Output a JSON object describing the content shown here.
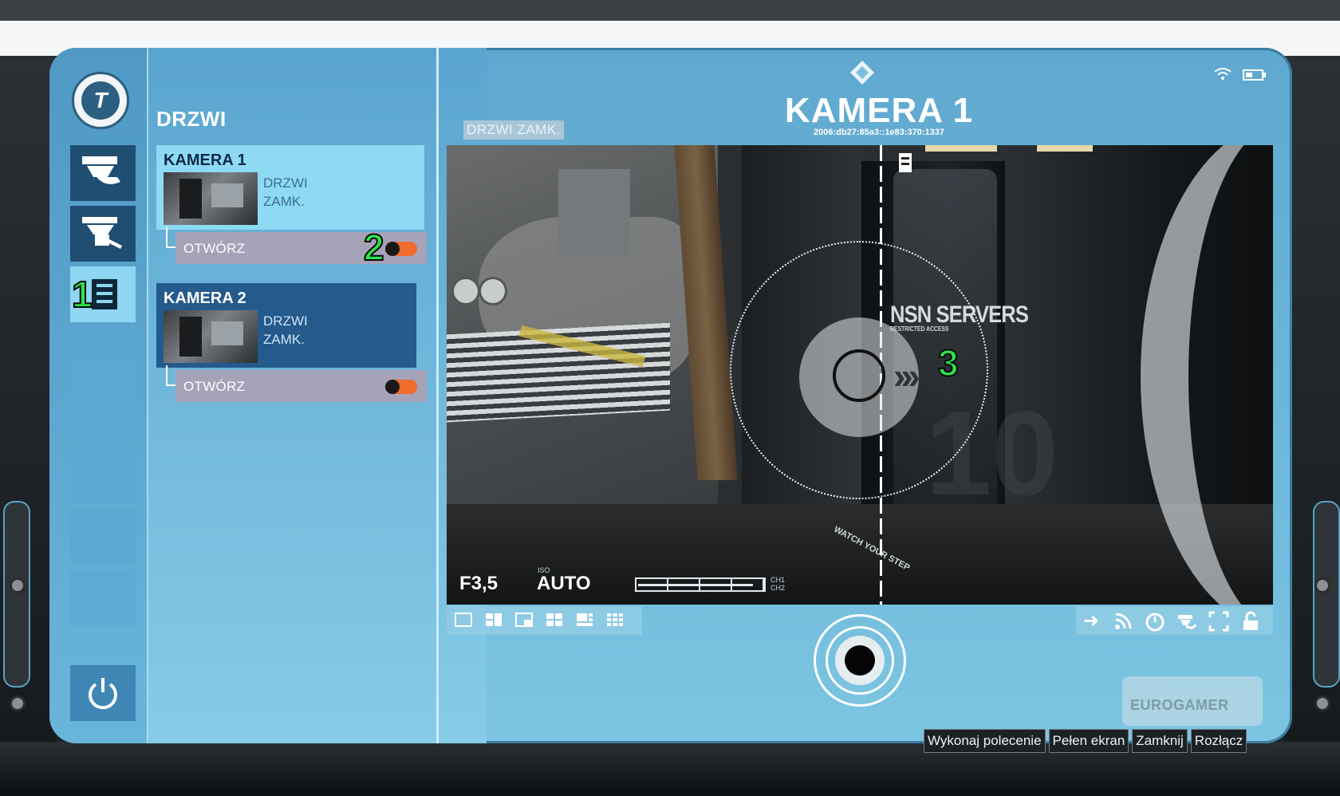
{
  "sidebar": {
    "logo_icon": "tf-logo-icon",
    "items": [
      {
        "icon": "camera-icon",
        "state": "dark"
      },
      {
        "icon": "camera-pan-icon",
        "state": "dark"
      },
      {
        "icon": "door-icon",
        "state": "active",
        "badge": "1"
      },
      {
        "icon": "",
        "state": "empty"
      },
      {
        "icon": "",
        "state": "empty"
      },
      {
        "icon": "",
        "state": "empty"
      },
      {
        "icon": "",
        "state": "empty"
      },
      {
        "icon": "",
        "state": "empty"
      }
    ],
    "power_icon": "power-icon"
  },
  "panel": {
    "title": "DRZWI",
    "cameras": [
      {
        "name": "KAMERA 1",
        "status_line1": "DRZWI",
        "status_line2": "ZAMK.",
        "door_label": "OTWÓRZ",
        "badge": "2",
        "toggle_on": true
      },
      {
        "name": "KAMERA 2",
        "status_line1": "DRZWI",
        "status_line2": "ZAMK.",
        "door_label": "OTWÓRZ",
        "toggle_on": false
      }
    ]
  },
  "viewer": {
    "status_tag": "DRZWI ZAMK.",
    "title": "KAMERA 1",
    "camera_id": "2006:db27:85a3::1e83:370:1337",
    "feed": {
      "sign_text": "NSN SERVERS",
      "sign_sub": "RESTRICTED ACCESS",
      "floor_text": "WATCH YOUR STEP",
      "big_number": "10",
      "badge": "3",
      "fnumber": "F3,5",
      "iso_label": "ISO",
      "iso_value": "AUTO",
      "ch1": "CH1",
      "ch2": "CH2",
      "meter_level": 0.92
    },
    "layout_buttons": [
      "layout-1x1-icon",
      "layout-2-icon",
      "layout-3-icon",
      "layout-4-icon",
      "layout-6-icon",
      "layout-9-icon"
    ],
    "action_icons": [
      "arrow-right-icon",
      "rss-icon",
      "timer-icon",
      "camera-rotate-icon",
      "fullscreen-icon",
      "lock-icon"
    ]
  },
  "watermark": "EUROGAMER",
  "commands": [
    "Wykonaj polecenie",
    "Pełen ekran",
    "Zamknij",
    "Rozłącz"
  ],
  "colors": {
    "accent": "#5fa8cf",
    "active_card": "#8edaf4",
    "dark_card": "#245a8c",
    "toggle": "#ef6c2c",
    "badge_green": "#2ee24a"
  }
}
